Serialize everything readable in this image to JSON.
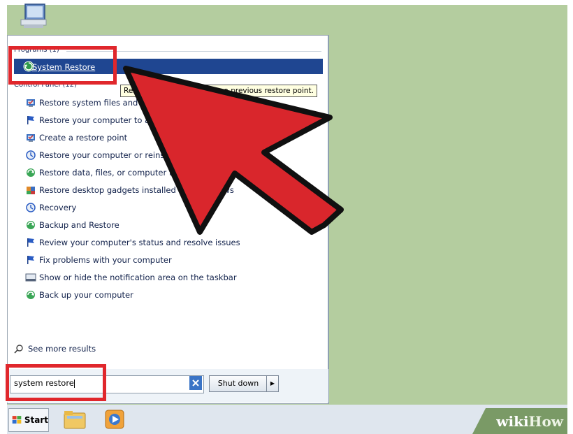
{
  "colors": {
    "highlight_red": "#e0272c",
    "arrow_fill": "#d9262c",
    "selected_row": "#1f4691",
    "desktop": "#b4cd9f"
  },
  "start_menu": {
    "programs_header": "Programs (1)",
    "selected_program": {
      "label": "System Restore",
      "icon": "system-restore-icon"
    },
    "tooltip": "Restores your computer to a previous restore point.",
    "control_panel_header": "Control Panel (12)",
    "items": [
      {
        "label": "Restore system files and settings from a restore point",
        "icon": "system-shield-icon"
      },
      {
        "label": "Restore your computer to an earlier time",
        "icon": "flag-icon"
      },
      {
        "label": "Create a restore point",
        "icon": "system-shield-icon"
      },
      {
        "label": "Restore your computer or reinstall Windows",
        "icon": "recovery-icon"
      },
      {
        "label": "Restore data, files, or computer from backup",
        "icon": "backup-icon"
      },
      {
        "label": "Restore desktop gadgets installed with Windows",
        "icon": "gadgets-icon"
      },
      {
        "label": "Recovery",
        "icon": "recovery-icon"
      },
      {
        "label": "Backup and Restore",
        "icon": "backup-icon"
      },
      {
        "label": "Review your computer's status and resolve issues",
        "icon": "flag-icon"
      },
      {
        "label": "Fix problems with your computer",
        "icon": "flag-icon"
      },
      {
        "label": "Show or hide the notification area on the taskbar",
        "icon": "taskbar-icon"
      },
      {
        "label": "Back up your computer",
        "icon": "backup-icon"
      }
    ],
    "see_more": "See more results",
    "search_value": "system restore",
    "shutdown_label": "Shut down",
    "shutdown_arrow": "▶"
  },
  "taskbar": {
    "start_label": "Start"
  },
  "watermark": {
    "wiki": "wiki",
    "how": "How"
  }
}
